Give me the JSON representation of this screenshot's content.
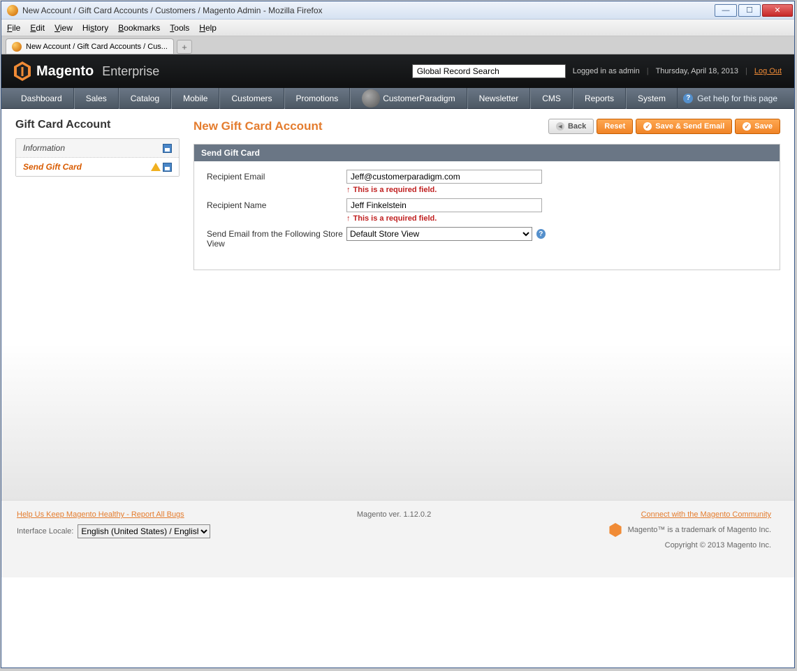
{
  "window": {
    "title": "New Account / Gift Card Accounts / Customers / Magento Admin - Mozilla Firefox",
    "tab_title": "New Account / Gift Card Accounts / Cus..."
  },
  "browser_menu": [
    "File",
    "Edit",
    "View",
    "History",
    "Bookmarks",
    "Tools",
    "Help"
  ],
  "header": {
    "brand": "Magento",
    "edition": "Enterprise",
    "search_placeholder": "Global Record Search",
    "logged_in": "Logged in as admin",
    "date": "Thursday, April 18, 2013",
    "logout": "Log Out"
  },
  "nav": [
    "Dashboard",
    "Sales",
    "Catalog",
    "Mobile",
    "Customers",
    "Promotions",
    "CustomerParadigm",
    "Newsletter",
    "CMS",
    "Reports",
    "System"
  ],
  "nav_help": "Get help for this page",
  "sidebar": {
    "title": "Gift Card Account",
    "tabs": [
      {
        "label": "Information",
        "active": false
      },
      {
        "label": "Send Gift Card",
        "active": true
      }
    ]
  },
  "page": {
    "title": "New Gift Card Account",
    "buttons": {
      "back": "Back",
      "reset": "Reset",
      "save_send": "Save & Send Email",
      "save": "Save"
    }
  },
  "section": {
    "head": "Send Gift Card",
    "fields": {
      "recipient_email": {
        "label": "Recipient Email",
        "value": "Jeff@customerparadigm.com",
        "error": "This is a required field."
      },
      "recipient_name": {
        "label": "Recipient Name",
        "value": "Jeff Finkelstein",
        "error": "This is a required field."
      },
      "store_view": {
        "label": "Send Email from the Following Store View",
        "value": "Default Store View"
      }
    }
  },
  "footer": {
    "bugs_link": "Help Us Keep Magento Healthy - Report All Bugs",
    "version": "Magento ver. 1.12.0.2",
    "community_link": "Connect with the Magento Community",
    "trademark": "Magento™ is a trademark of Magento Inc.",
    "copyright": "Copyright © 2013 Magento Inc.",
    "locale_label": "Interface Locale:",
    "locale_value": "English (United States) / English"
  }
}
